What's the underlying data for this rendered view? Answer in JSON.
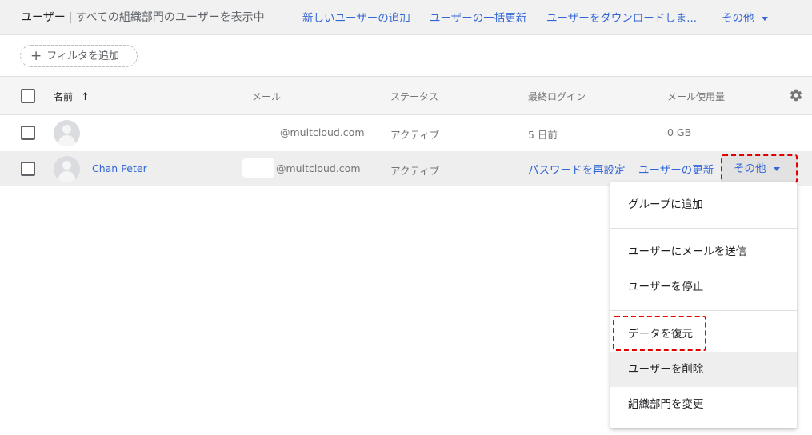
{
  "header": {
    "title_main": "ユーザー",
    "title_sep": "|",
    "title_sub": "すべての組織部門のユーザーを表示中",
    "actions": {
      "add_user": "新しいユーザーの追加",
      "bulk_update": "ユーザーの一括更新",
      "download": "ユーザーをダウンロードしま...",
      "more": "その他"
    }
  },
  "filter": {
    "label": "フィルタを追加",
    "plus": "+"
  },
  "table": {
    "columns": {
      "name": "名前",
      "sort_arrow": "↑",
      "email": "メール",
      "status": "ステータス",
      "last_login": "最終ログイン",
      "email_usage": "メール使用量"
    },
    "rows": [
      {
        "name": "",
        "email": "@multcloud.com",
        "status": "アクティブ",
        "last_login": "5 日前",
        "email_usage": "0 GB"
      },
      {
        "name": "Chan Peter",
        "email": "@multcloud.com",
        "status": "アクティブ",
        "actions": {
          "reset_password": "パスワードを再設定",
          "update_user": "ユーザーの更新",
          "more": "その他"
        }
      }
    ]
  },
  "menu": {
    "items": [
      "グループに追加",
      "ユーザーにメールを送信",
      "ユーザーを停止",
      "データを復元",
      "ユーザーを削除",
      "組織部門を変更"
    ]
  },
  "colors": {
    "link": "#3367d6",
    "highlight": "#e00000"
  }
}
